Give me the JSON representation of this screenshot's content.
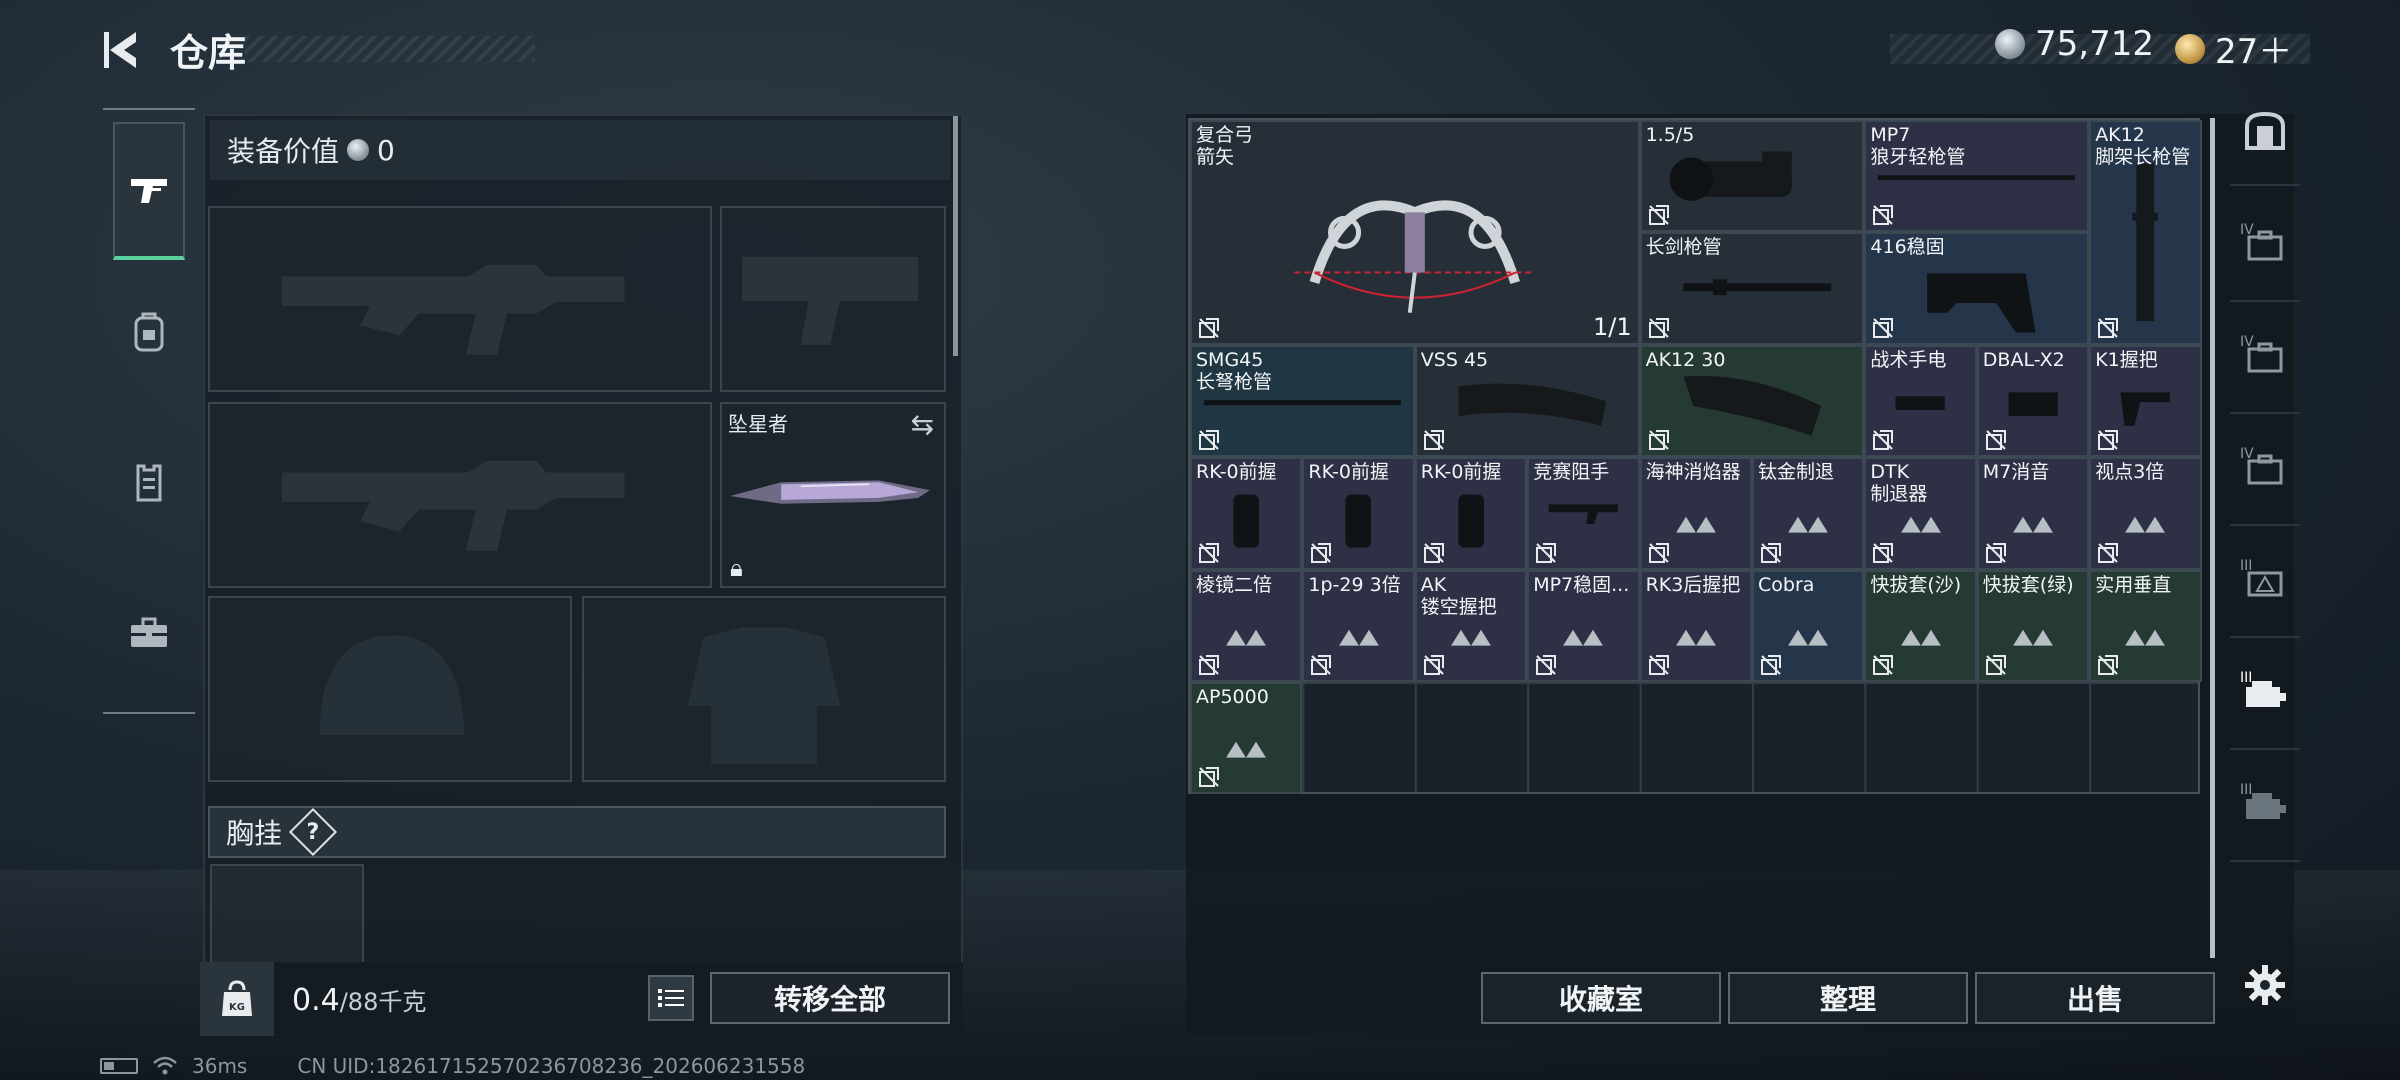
{
  "header": {
    "title": "仓库"
  },
  "currency": [
    {
      "icon": "silver-coin-icon",
      "amount": "75,712"
    },
    {
      "icon": "gold-coin-icon",
      "amount": "27＋"
    }
  ],
  "left_nav": [
    {
      "icon": "pistol-icon",
      "active": true
    },
    {
      "icon": "backpack-icon",
      "active": false
    },
    {
      "icon": "vest-icon",
      "active": false
    },
    {
      "icon": "toolbox-icon",
      "active": false
    }
  ],
  "loadout": {
    "value_label": "装备价值",
    "value_amount": "0",
    "melee_label": "坠星者",
    "chest_rig_label": "胸挂",
    "help_glyph": "?",
    "weight_current": "0.4",
    "weight_max": "/88千克",
    "transfer_all_label": "转移全部"
  },
  "storage": {
    "items": [
      {
        "name": "复合弓\n箭矢",
        "count": "1/1"
      },
      {
        "name": "1.5/5"
      },
      {
        "name": "MP7\n狼牙轻枪管"
      },
      {
        "name": "AK12\n脚架长枪管"
      },
      {
        "name": "长剑枪管"
      },
      {
        "name": "416稳固"
      },
      {
        "name": "SMG45\n长弩枪管"
      },
      {
        "name": "VSS 45"
      },
      {
        "name": "AK12 30"
      },
      {
        "name": "战术手电"
      },
      {
        "name": "DBAL-X2"
      },
      {
        "name": "K1握把"
      },
      {
        "name": "RK-0前握"
      },
      {
        "name": "RK-0前握"
      },
      {
        "name": "RK-0前握"
      },
      {
        "name": "竞赛阻手"
      },
      {
        "name": "海神消焰器"
      },
      {
        "name": "钛金制退"
      },
      {
        "name": "DTK\n制退器"
      },
      {
        "name": "M7消音"
      },
      {
        "name": "视点3倍"
      },
      {
        "name": "棱镜二倍"
      },
      {
        "name": "1p-29 3倍"
      },
      {
        "name": "AK\n镂空握把"
      },
      {
        "name": "MP7稳固..."
      },
      {
        "name": "RK3后握把"
      },
      {
        "name": "Cobra"
      },
      {
        "name": "快拔套(沙)"
      },
      {
        "name": "快拔套(绿)"
      },
      {
        "name": "实用垂直"
      },
      {
        "name": "AP5000"
      }
    ],
    "buttons": {
      "collection": "收藏室",
      "organize": "整理",
      "sell": "出售"
    }
  },
  "right_nav": [
    {
      "icon": "safe-box-icon"
    },
    {
      "tier": "IV",
      "icon": "tier4-case-icon"
    },
    {
      "tier": "IV",
      "icon": "tier4-case-icon"
    },
    {
      "tier": "IV",
      "icon": "tier4-case-icon"
    },
    {
      "tier": "III",
      "icon": "tier3-case-icon"
    },
    {
      "tier": "III",
      "icon": "tier3-case-icon"
    },
    {
      "tier": "III",
      "icon": "tier3-case-icon"
    },
    {
      "icon": "settings-gear-icon"
    }
  ],
  "status_bar": {
    "ping": "36ms",
    "uid": "CN UID:182617152570236708236_202606231558"
  },
  "colors": {
    "accent_green": "#59d19a"
  }
}
